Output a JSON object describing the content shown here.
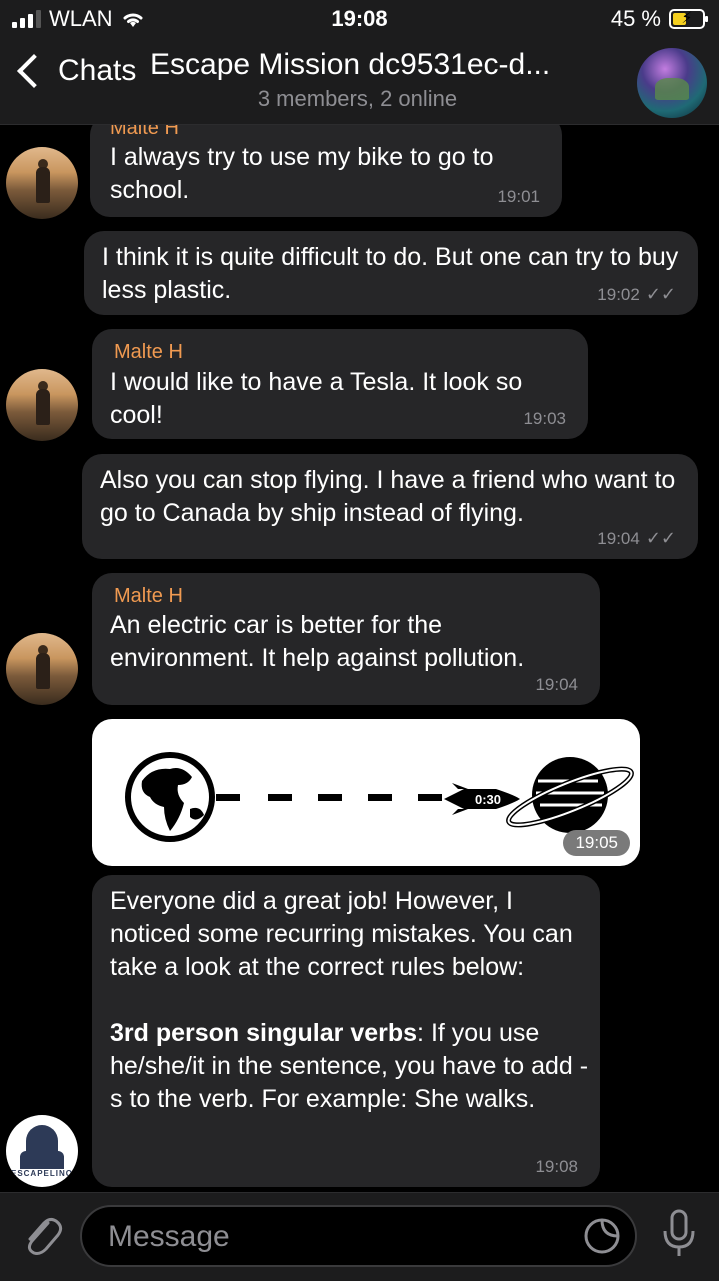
{
  "status": {
    "carrier": "WLAN",
    "time": "19:08",
    "battery": "45 %",
    "battery_level": 0.45
  },
  "header": {
    "back_label": "Chats",
    "title": "Escape Mission dc9531ec-d...",
    "subtitle": "3 members, 2 online"
  },
  "messages": [
    {
      "sender": "Malte H",
      "text": "I always try to use my bike to go to school.",
      "time": "19:01"
    },
    {
      "text": "I think it is quite difficult to do. But one can try to buy less plastic.",
      "time": "19:02"
    },
    {
      "sender": "Malte H",
      "text": "I would like to have a Tesla. It look so cool!",
      "time": "19:03"
    },
    {
      "text": "Also you can stop flying. I have a friend who want to go to Canada by ship instead of flying.",
      "time": "19:04"
    },
    {
      "sender": "Malte H",
      "text": "An electric car is better for the environment. It help against pollution.",
      "time": "19:04"
    },
    {
      "image_timer": "0:30",
      "time": "19:05"
    },
    {
      "text_intro": "Everyone did a great job! However, I noticed some recurring mistakes. You can take a look at the correct rules below:",
      "rule_title": "3rd person singular verbs",
      "rule_text": ": If you use he/she/it in the sentence, you have to add -s to the verb. For example: She walks.",
      "time": "19:08",
      "avatar_brand": "ESCAPELINO"
    }
  ],
  "read_mark": "✓✓",
  "input": {
    "placeholder": "Message"
  }
}
